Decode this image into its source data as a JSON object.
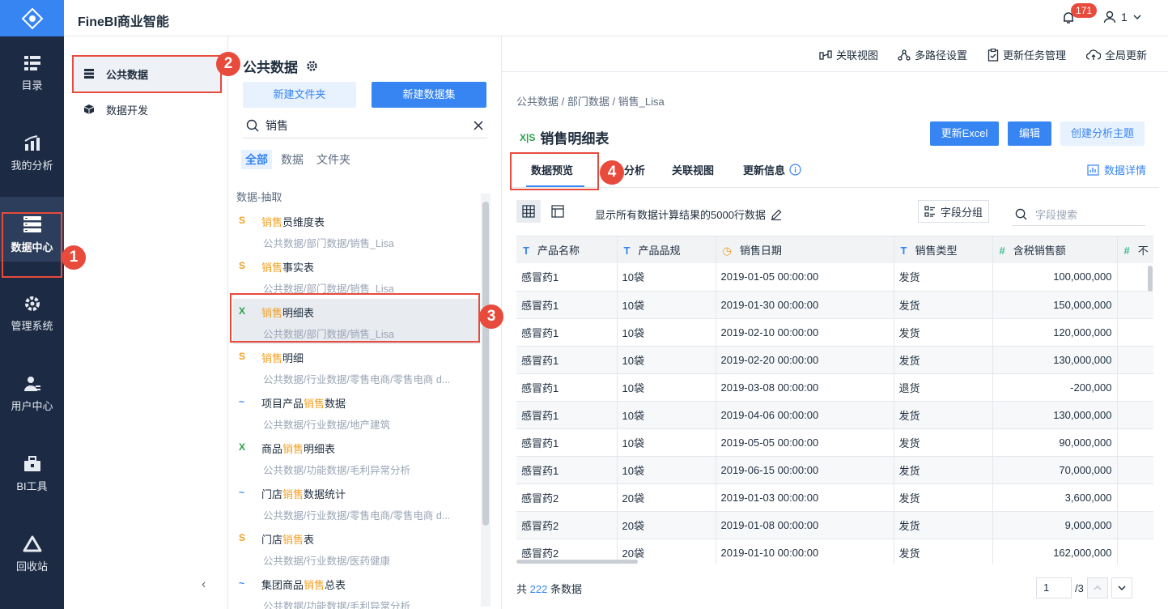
{
  "app": {
    "title": "FineBI商业智能",
    "notification_count": "171",
    "user": "1"
  },
  "sidenav": [
    {
      "label": "目录",
      "icon": "catalog-icon"
    },
    {
      "label": "我的分析",
      "icon": "analysis-icon"
    },
    {
      "label": "数据中心",
      "icon": "data-center-icon"
    },
    {
      "label": "管理系统",
      "icon": "gear-icon"
    },
    {
      "label": "用户中心",
      "icon": "user-icon"
    },
    {
      "label": "BI工具",
      "icon": "toolbox-icon"
    },
    {
      "label": "回收站",
      "icon": "recycle-icon"
    }
  ],
  "panel1": {
    "items": [
      {
        "label": "公共数据"
      },
      {
        "label": "数据开发"
      }
    ]
  },
  "panel2": {
    "title": "公共数据",
    "new_folder": "新建文件夹",
    "new_dataset": "新建数据集",
    "search_value": "销售",
    "filters": [
      "全部",
      "数据",
      "文件夹"
    ],
    "group_head": "数据-抽取",
    "datasets": [
      {
        "icon": "sql",
        "pre": "",
        "hl": "销售",
        "post": "员维度表",
        "path": "公共数据/部门数据/销售_Lisa"
      },
      {
        "icon": "sql",
        "pre": "",
        "hl": "销售",
        "post": "事实表",
        "path": "公共数据/部门数据/销售_Lisa"
      },
      {
        "icon": "xls",
        "pre": "",
        "hl": "销售",
        "post": "明细表",
        "path": "公共数据/部门数据/销售_Lisa"
      },
      {
        "icon": "sql",
        "pre": "",
        "hl": "销售",
        "post": "明细",
        "path": "公共数据/行业数据/零售电商/零售电商 d..."
      },
      {
        "icon": "self",
        "pre": "项目产品",
        "hl": "销售",
        "post": "数据",
        "path": "公共数据/行业数据/地产建筑"
      },
      {
        "icon": "xls",
        "pre": "商品",
        "hl": "销售",
        "post": "明细表",
        "path": "公共数据/功能数据/毛利异常分析"
      },
      {
        "icon": "self",
        "pre": "门店",
        "hl": "销售",
        "post": "数据统计",
        "path": "公共数据/行业数据/零售电商/零售电商 d..."
      },
      {
        "icon": "sql",
        "pre": "门店",
        "hl": "销售",
        "post": "表",
        "path": "公共数据/行业数据/医药健康"
      },
      {
        "icon": "self",
        "pre": "集团商品",
        "hl": "销售",
        "post": "总表",
        "path": "公共数据/功能数据/毛利异常分析"
      }
    ],
    "icon_text": {
      "sql": "S",
      "xls": "X",
      "self": "~"
    }
  },
  "toolbar": [
    "关联视图",
    "多路径设置",
    "更新任务管理",
    "全局更新"
  ],
  "breadcrumb": "公共数据 / 部门数据 / 销售_Lisa",
  "dataset": {
    "title": "销售明细表",
    "update_excel": "更新Excel",
    "edit": "编辑",
    "create_subject": "创建分析主题"
  },
  "tabs": [
    "数据预览",
    "分析",
    "关联视图",
    "更新信息"
  ],
  "data_detail": "数据详情",
  "row_info": "显示所有数据计算结果的5000行数据",
  "field_group": "字段分组",
  "field_search_placeholder": "字段搜索",
  "table": {
    "columns": [
      {
        "type": "T",
        "name": "产品名称"
      },
      {
        "type": "T",
        "name": "产品品规"
      },
      {
        "type": "D",
        "name": "销售日期"
      },
      {
        "type": "T",
        "name": "销售类型"
      },
      {
        "type": "#",
        "name": "含税销售额"
      },
      {
        "type": "#",
        "name": "不"
      }
    ],
    "rows": [
      [
        "感冒药1",
        "10袋",
        "2019-01-05 00:00:00",
        "发货",
        "100,000,000"
      ],
      [
        "感冒药1",
        "10袋",
        "2019-01-30 00:00:00",
        "发货",
        "150,000,000"
      ],
      [
        "感冒药1",
        "10袋",
        "2019-02-10 00:00:00",
        "发货",
        "120,000,000"
      ],
      [
        "感冒药1",
        "10袋",
        "2019-02-20 00:00:00",
        "发货",
        "130,000,000"
      ],
      [
        "感冒药1",
        "10袋",
        "2019-03-08 00:00:00",
        "退货",
        "-200,000"
      ],
      [
        "感冒药1",
        "10袋",
        "2019-04-06 00:00:00",
        "发货",
        "130,000,000"
      ],
      [
        "感冒药1",
        "10袋",
        "2019-05-05 00:00:00",
        "发货",
        "90,000,000"
      ],
      [
        "感冒药1",
        "10袋",
        "2019-06-15 00:00:00",
        "发货",
        "70,000,000"
      ],
      [
        "感冒药2",
        "20袋",
        "2019-01-03 00:00:00",
        "发货",
        "3,600,000"
      ],
      [
        "感冒药2",
        "20袋",
        "2019-01-08 00:00:00",
        "发货",
        "9,000,000"
      ],
      [
        "感冒药2",
        "20袋",
        "2019-01-10 00:00:00",
        "发货",
        "162,000,000"
      ],
      [
        "",
        "",
        "",
        "",
        ""
      ]
    ]
  },
  "footer": {
    "pre": "共",
    "count": "222",
    "post": "条数据",
    "page": "1",
    "total": "/3"
  },
  "annotations": [
    "1",
    "2",
    "3",
    "4"
  ]
}
